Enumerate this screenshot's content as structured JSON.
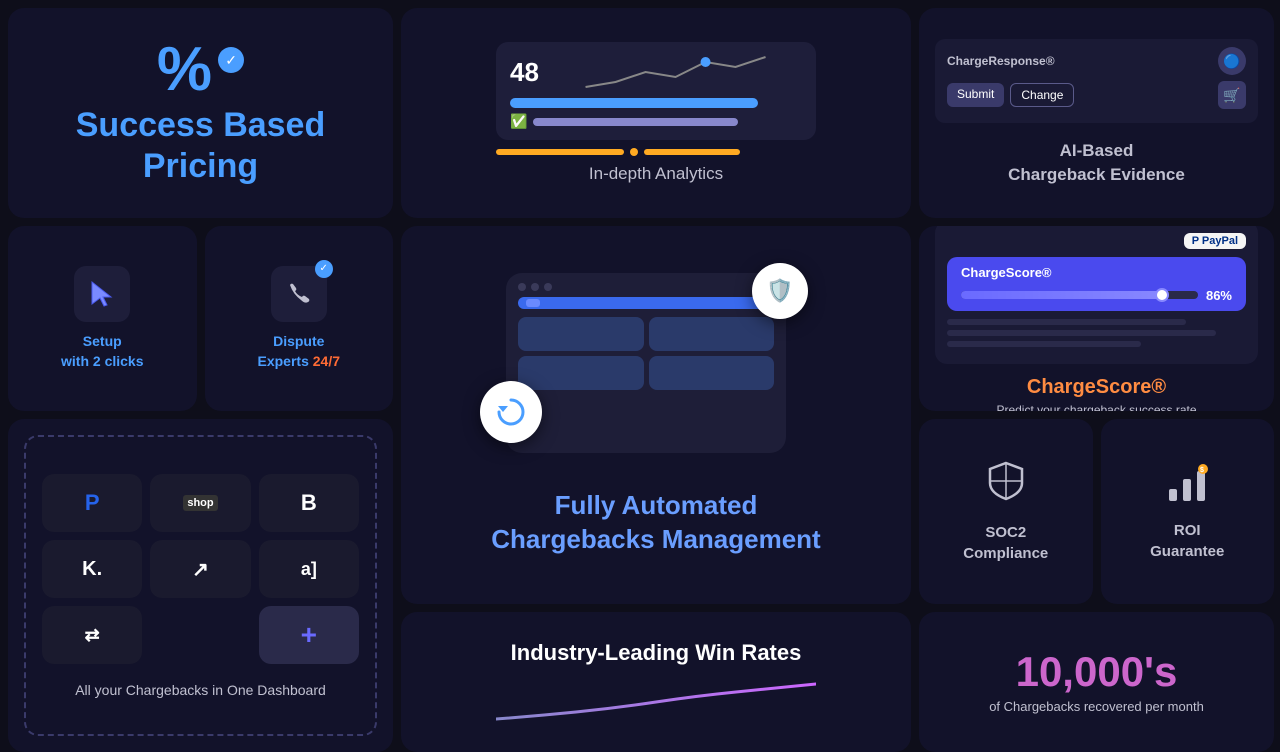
{
  "cards": {
    "pricing": {
      "symbol": "%",
      "title_line1": "Success Based",
      "title_line2": "Pricing"
    },
    "analytics": {
      "label": "In-depth Analytics",
      "number": "48"
    },
    "ai": {
      "title_line1": "AI-Based",
      "title_line2": "Chargeback Evidence",
      "charge_response": "ChargeResponse®",
      "submit_label": "Submit",
      "change_label": "Change"
    },
    "chargescore": {
      "title": "ChargeScore®",
      "subtitle": "Predict your chargeback success rate",
      "paypal_label": "P PayPal",
      "score_label": "ChargeScore®",
      "score_value": "86%"
    },
    "setup": {
      "label_line1": "Setup",
      "label_line2_prefix": "with ",
      "label_line2_highlight": "2 clicks"
    },
    "dispute": {
      "label_line1": "Dispute",
      "label_line2_prefix": "Experts ",
      "label_line2_highlight": "24/7"
    },
    "automated": {
      "title_line1": "Fully Automated",
      "title_line2": "Chargebacks Management"
    },
    "integrations": {
      "label": "All your Chargebacks in One Dashboard",
      "icons": [
        "P",
        "shop",
        "B",
        "K",
        "↗",
        "a]",
        "⇄",
        "+"
      ]
    },
    "soc2": {
      "label_line1": "SOC2",
      "label_line2": "Compliance"
    },
    "roi": {
      "label_line1": "ROI",
      "label_line2": "Guarantee"
    },
    "win_rates": {
      "title": "Industry-Leading Win Rates"
    },
    "thousands": {
      "number": "10,000's",
      "subtitle": "of Chargebacks recovered per month"
    }
  }
}
